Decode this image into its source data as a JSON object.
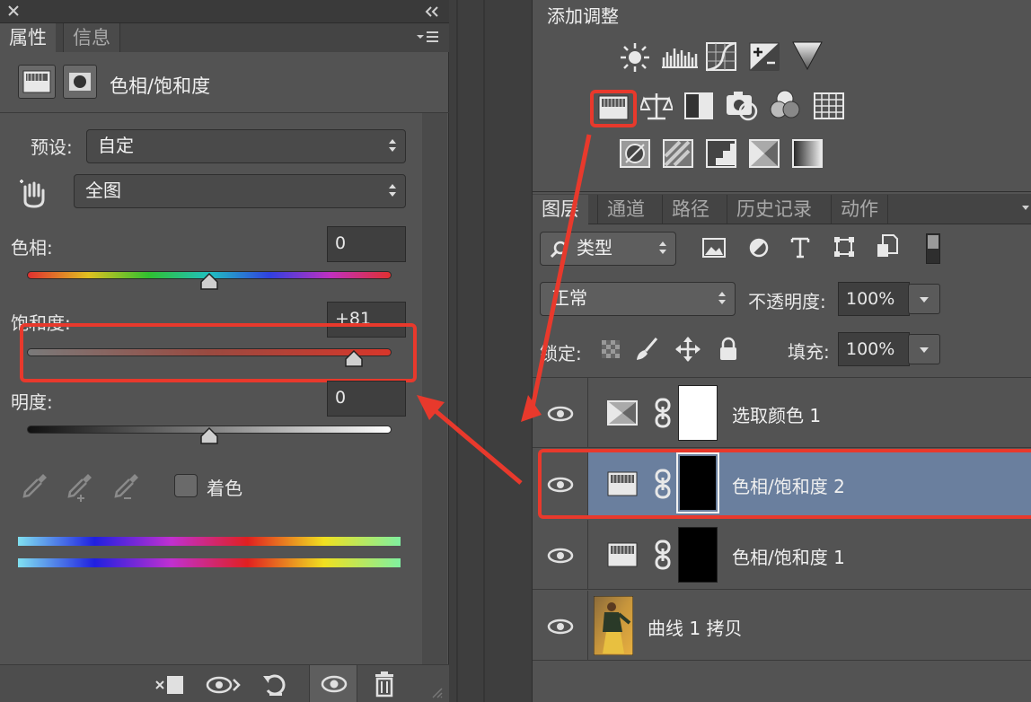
{
  "left_panel": {
    "tabs": [
      "属性",
      "信息"
    ],
    "adjustment_title": "色相/饱和度",
    "preset_label": "预设:",
    "preset_value": "自定",
    "channel_value": "全图",
    "hue_label": "色相:",
    "hue_value": "0",
    "hue_level": 0.5,
    "saturation_label": "饱和度:",
    "saturation_value": "+81",
    "saturation_level": 0.9,
    "lightness_label": "明度:",
    "lightness_value": "0",
    "lightness_level": 0.5,
    "colorize_label": "着色"
  },
  "adjust_panel": {
    "title": "添加调整"
  },
  "layers_panel": {
    "tabs": [
      "图层",
      "通道",
      "路径",
      "历史记录",
      "动作"
    ],
    "filter_value": "类型",
    "blend_mode": "正常",
    "opacity_label": "不透明度:",
    "opacity_value": "100%",
    "lock_label": "锁定:",
    "fill_label": "填充:",
    "fill_value": "100%",
    "layers": [
      {
        "name": "选取颜色 1",
        "icon": "selective-color-icon",
        "mask": "white"
      },
      {
        "name": "色相/饱和度 2",
        "icon": "hue-saturation-icon",
        "mask": "black"
      },
      {
        "name": "色相/饱和度 1",
        "icon": "hue-saturation-icon",
        "mask": "black"
      },
      {
        "name": "曲线 1 拷贝",
        "icon": "photo-thumbnail",
        "mask": "none"
      }
    ]
  },
  "colors": {
    "annotation_red": "#e8392c",
    "selected_layer": "#6a7f9e",
    "panel_bg": "#535353"
  }
}
